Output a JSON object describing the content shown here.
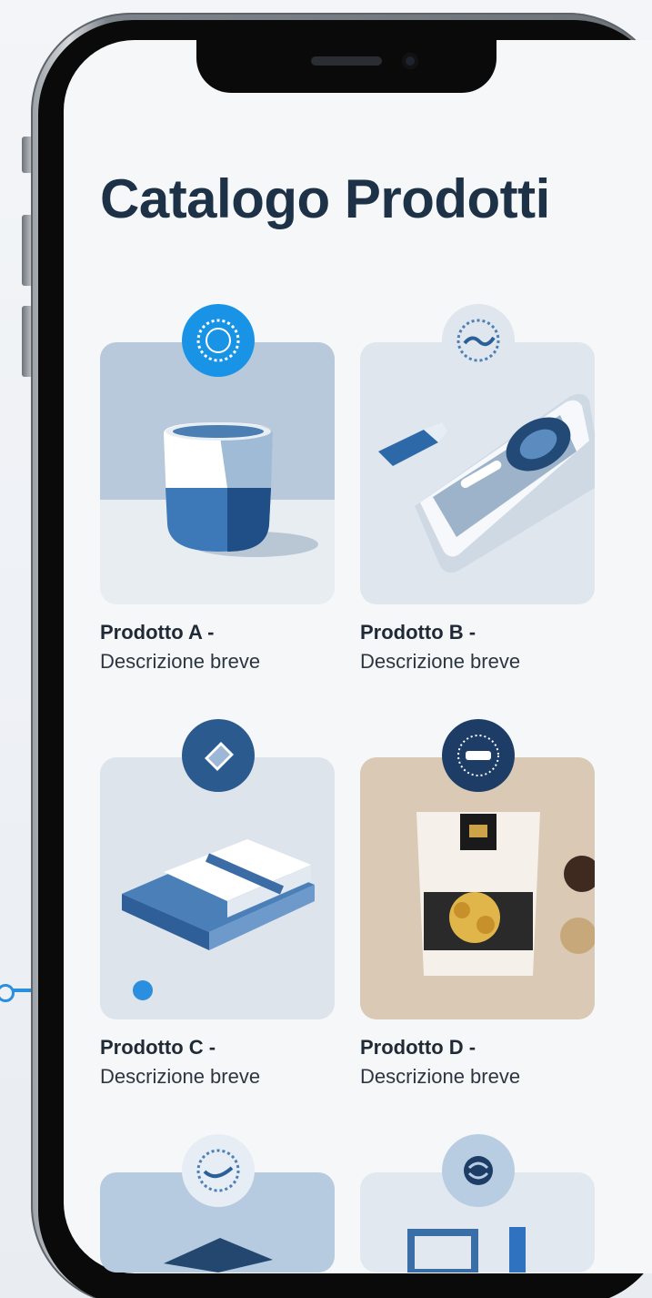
{
  "header": {
    "title": "Catalogo Prodotti"
  },
  "products": [
    {
      "name": "Prodotto A -",
      "description": "Descrizione breve",
      "icon": "cup-icon",
      "badge_icon": "seal-icon"
    },
    {
      "name": "Prodotto B -",
      "description": "Descrizione breve",
      "icon": "phone-device-icon",
      "badge_icon": "wave-seal-icon"
    },
    {
      "name": "Prodotto C -",
      "description": "Descrizione breve",
      "icon": "folded-towel-icon",
      "badge_icon": "tag-icon"
    },
    {
      "name": "Prodotto D -",
      "description": "Descrizione breve",
      "icon": "snack-bag-icon",
      "badge_icon": "emblem-icon"
    }
  ],
  "colors": {
    "title": "#1d3147",
    "accent_blue": "#2b8fe0",
    "navy": "#24476f",
    "card_bg": "#dde4ec",
    "beige": "#d9c9b5"
  }
}
